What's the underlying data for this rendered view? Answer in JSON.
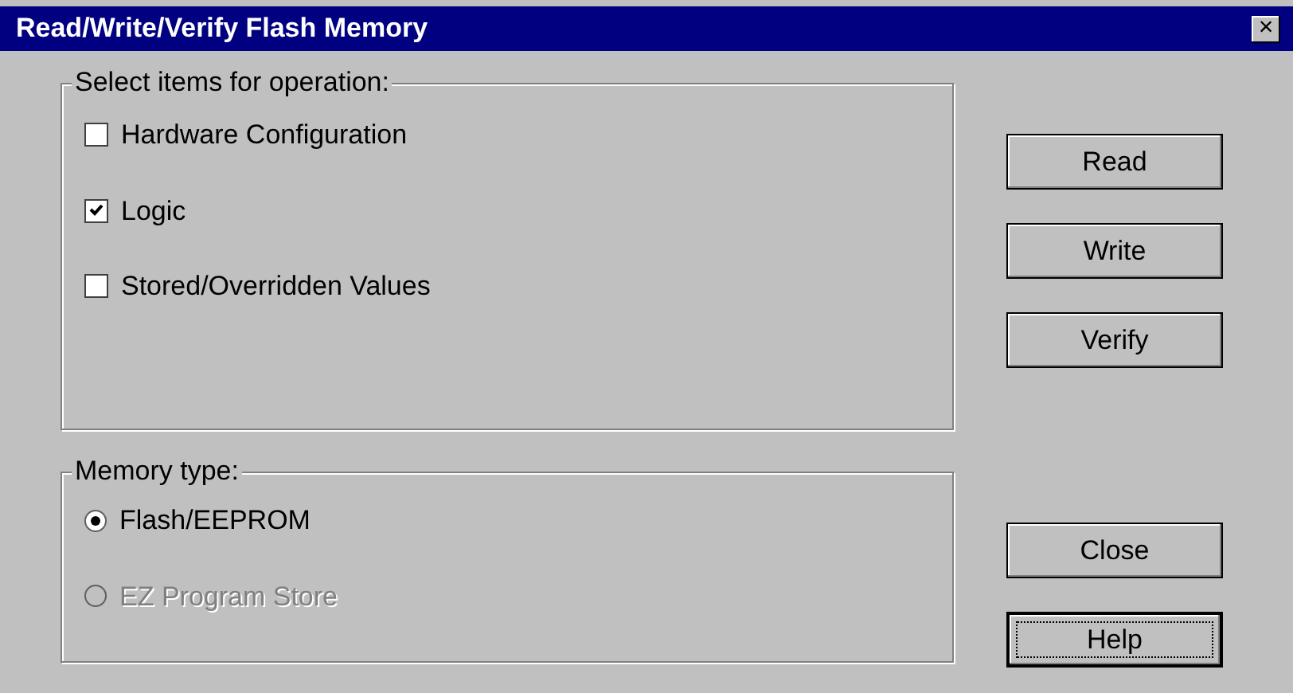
{
  "window": {
    "title": "Read/Write/Verify Flash Memory",
    "close_glyph": "×"
  },
  "items_group": {
    "label": "Select items for operation:",
    "options": [
      {
        "label": "Hardware Configuration",
        "checked": false
      },
      {
        "label": "Logic",
        "checked": true
      },
      {
        "label": "Stored/Overridden Values",
        "checked": false
      }
    ]
  },
  "memory_group": {
    "label": "Memory type:",
    "options": [
      {
        "label": "Flash/EEPROM",
        "selected": true,
        "disabled": false
      },
      {
        "label": "EZ Program Store",
        "selected": false,
        "disabled": true
      }
    ]
  },
  "buttons_top": [
    {
      "label": "Read",
      "default": false
    },
    {
      "label": "Write",
      "default": false
    },
    {
      "label": "Verify",
      "default": false
    }
  ],
  "buttons_bottom": [
    {
      "label": "Close",
      "default": false
    },
    {
      "label": "Help",
      "default": true
    }
  ]
}
